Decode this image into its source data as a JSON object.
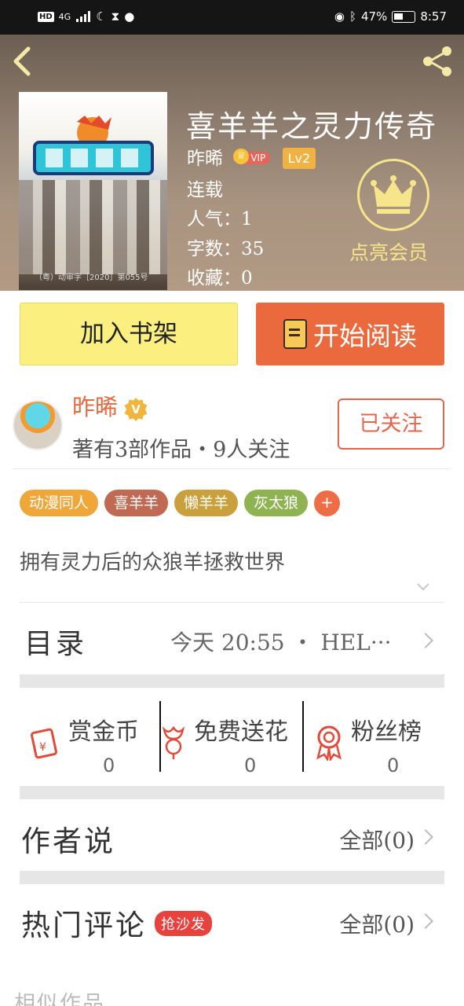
{
  "status_bar": {
    "network": "4G",
    "battery": "47%",
    "time": "8:57"
  },
  "header": {
    "book_title": "喜羊羊之灵力传奇",
    "author": "昨晞",
    "vip_badge": "VIP",
    "level_badge": "Lv2",
    "status": "连载",
    "popularity": "人气：1",
    "word_count": "字数：35",
    "favorites": "收藏：0",
    "vip_cta": "点亮会员",
    "cover_code": "（粤）动审字［2020］第055号"
  },
  "actions": {
    "add_to_shelf": "加入书架",
    "start_reading": "开始阅读"
  },
  "author_card": {
    "name": "昨晞",
    "verified_badge": "V",
    "stats": "著有3部作品・9人关注",
    "follow_label": "已关注"
  },
  "tags": [
    {
      "label": "动漫同人",
      "color": "#f0a73a"
    },
    {
      "label": "喜羊羊",
      "color": "#c06a53"
    },
    {
      "label": "懒羊羊",
      "color": "#caa03c"
    },
    {
      "label": "灰太狼",
      "color": "#8fb350"
    }
  ],
  "tag_add": "+",
  "description": "拥有灵力后的众狼羊拯救世界",
  "toc": {
    "label": "目录",
    "latest": "今天 20:55 ・ HEL···"
  },
  "rewards": [
    {
      "label": "赏金币",
      "value": "0",
      "icon": "red-envelope-icon"
    },
    {
      "label": "免费送花",
      "value": "0",
      "icon": "flower-icon"
    },
    {
      "label": "粉丝榜",
      "value": "0",
      "icon": "award-ribbon-icon"
    }
  ],
  "author_says": {
    "title": "作者说",
    "all": "全部(0)"
  },
  "hot_comments": {
    "title": "热门评论",
    "badge": "抢沙发",
    "all": "全部(0)"
  },
  "similar_title": "相似作品",
  "colors": {
    "accent_orange": "#ea6a3e",
    "shelf_yellow": "#fbf07f",
    "gold": "#f6e58a"
  }
}
